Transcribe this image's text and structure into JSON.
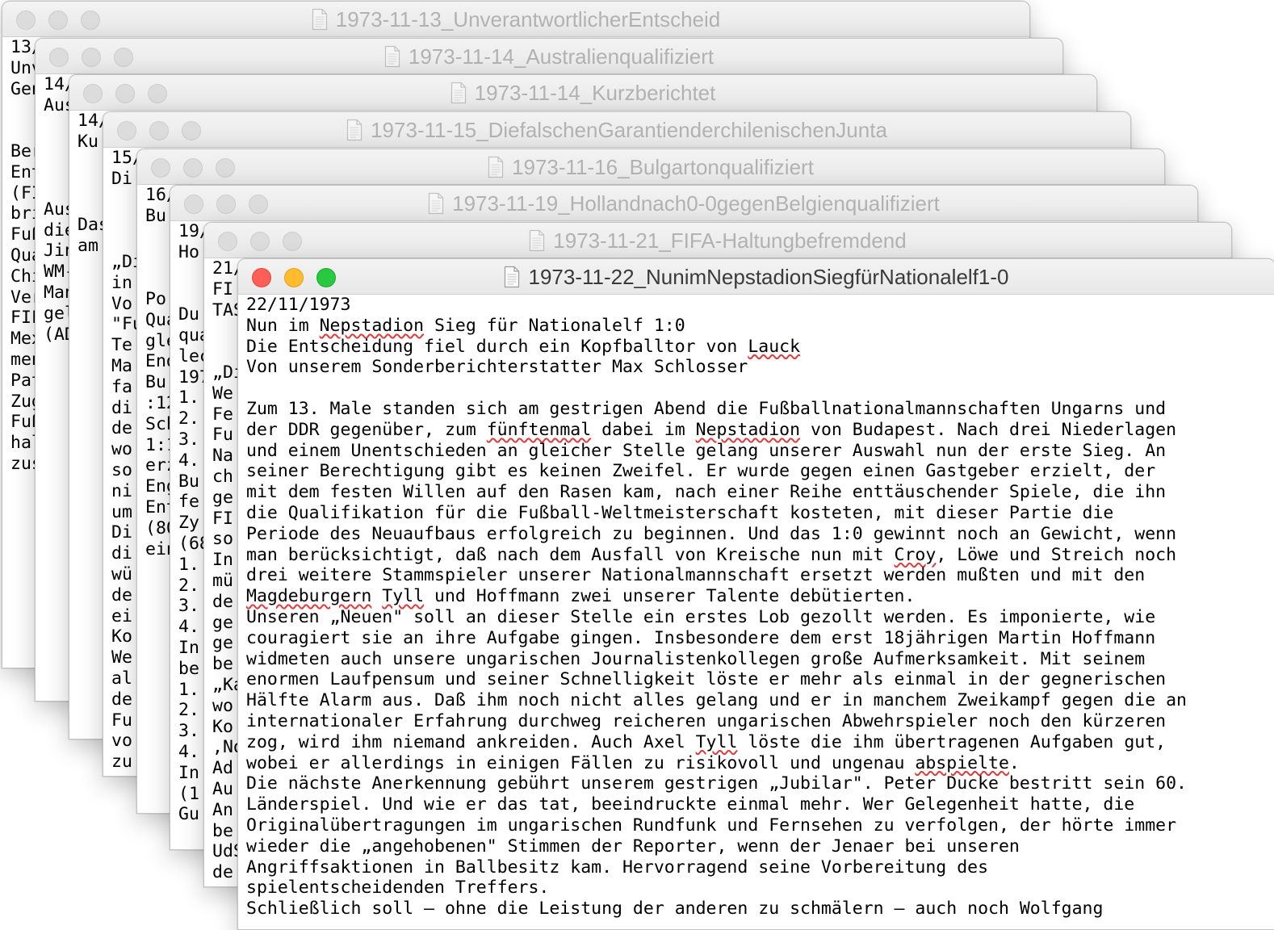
{
  "windows": [
    {
      "title": "1973-11-13_UnverantwortlicherEntscheid",
      "lines": [
        "13/",
        "Unv",
        "Gen",
        "",
        "",
        "Ber",
        "Ent",
        "(FI",
        "bri",
        "Fuß",
        "Qua",
        "Chi",
        "Ver",
        "FIF",
        "Mex",
        "men",
        "Pat",
        "Zug",
        "Fuß",
        "hal",
        "zus"
      ]
    },
    {
      "title": "1973-11-14_Australienqualifiziert",
      "lines": [
        "14/",
        "Aus",
        "",
        "",
        "",
        "",
        "Aus",
        "die",
        "Jin",
        "WM-",
        "Man",
        "gel",
        "(AD"
      ]
    },
    {
      "title": "1973-11-14_Kurzberichtet",
      "lines": [
        "14/",
        "Ku",
        "",
        "",
        "",
        "Das",
        "am"
      ]
    },
    {
      "title": "1973-11-15_DiefalschenGarantienderchilenischenJunta",
      "lines": [
        "15/",
        "Di",
        "",
        "",
        "",
        "„Di",
        "in",
        "Vo",
        "\"Fu",
        "Te",
        "Ma",
        "fa",
        "di",
        "de",
        "wo",
        "so",
        "ni",
        "um",
        "Di",
        "di",
        "wü",
        "de",
        "ei",
        "Ko",
        "We",
        "al",
        "de",
        "Fu",
        "vo",
        "zu"
      ]
    },
    {
      "title": "1973-11-16_Bulgartonqualifiziert",
      "lines": [
        "16/",
        "Bu",
        "",
        "",
        "",
        "Po",
        "Qua",
        "gle",
        "End",
        "Bu",
        ":12",
        "Sch",
        "1:1",
        "erz",
        "Eng",
        "Ent",
        "(80",
        "ein"
      ]
    },
    {
      "title": "1973-11-19_Hollandnach0-0gegenBelgienqualifiziert",
      "lines": [
        "19/",
        "Ho",
        "",
        "",
        "Du",
        "qua",
        "lec",
        "197",
        "1.",
        "2.",
        "3.",
        "4.",
        "Bu",
        "fe",
        "Zy",
        "(68",
        "1.",
        "2.",
        "3.",
        "4.",
        "In",
        "be",
        "1.",
        "2.",
        "3.",
        "4.",
        "In",
        "(1",
        "Gu"
      ]
    },
    {
      "title": "1973-11-21_FIFA-Haltungbefremdend",
      "lines": [
        "21/",
        "FI",
        "TAS",
        "",
        "",
        "„Di",
        "We",
        "Fe",
        "Fu",
        "Na",
        "ch",
        "ge",
        "FI",
        "so",
        "In",
        "mü",
        "de",
        "ge",
        "ge",
        "be",
        "„Ka",
        "wo",
        "Ko",
        ",No",
        "Ad",
        "Au",
        "An",
        "be",
        "UdS",
        "de"
      ]
    },
    {
      "title": "1973-11-22_NunimNepstadionSiegfürNationalelf1-0",
      "lines": [
        "22/11/1973",
        "Nun im Nepstadion Sieg für Nationalelf 1:0",
        "Die Entscheidung fiel durch ein Kopfballtor von Lauck",
        "Von unserem Sonderberichterstatter Max Schlosser",
        "",
        "Zum 13. Male standen sich am gestrigen Abend die Fußballnationalmannschaften Ungarns und",
        "der DDR gegenüber, zum fünftenmal dabei im Nepstadion von Budapest. Nach drei Niederlagen",
        "und einem Unentschieden an gleicher Stelle gelang unserer Auswahl nun der erste Sieg. An",
        "seiner Berechtigung gibt es keinen Zweifel. Er wurde gegen einen Gastgeber erzielt, der",
        "mit dem festen Willen auf den Rasen kam, nach einer Reihe enttäuschender Spiele, die ihn",
        "die Qualifikation für die Fußball-Weltmeisterschaft kosteten, mit dieser Partie die",
        "Periode des Neuaufbaus erfolgreich zu beginnen. Und das 1:0 gewinnt noch an Gewicht, wenn",
        "man berücksichtigt, daß nach dem Ausfall von Kreische nun mit Croy, Löwe und Streich noch",
        "drei weitere Stammspieler unserer Nationalmannschaft ersetzt werden mußten und mit den",
        "Magdeburgern Tyll und Hoffmann zwei unserer Talente debütierten.",
        "Unseren „Neuen\" soll an dieser Stelle ein erstes Lob gezollt werden. Es imponierte, wie",
        "couragiert sie an ihre Aufgabe gingen. Insbesondere dem erst 18jährigen Martin Hoffmann",
        "widmeten auch unsere ungarischen Journalistenkollegen große Aufmerksamkeit. Mit seinem",
        "enormen Laufpensum und seiner Schnelligkeit löste er mehr als einmal in der gegnerischen",
        "Hälfte Alarm aus. Daß ihm noch nicht alles gelang und er in manchem Zweikampf gegen die an",
        "internationaler Erfahrung durchweg reicheren ungarischen Abwehrspieler noch den kürzeren",
        "zog, wird ihm niemand ankreiden. Auch Axel Tyll löste die ihm übertragenen Aufgaben gut,",
        "wobei er allerdings in einigen Fällen zu risikovoll und ungenau abspielte.",
        "Die nächste Anerkennung gebührt unserem gestrigen „Jubilar\". Peter Ducke bestritt sein 60.",
        "Länderspiel. Und wie er das tat, beeindruckte einmal mehr. Wer Gelegenheit hatte, die",
        "Originalübertragungen im ungarischen Rundfunk und Fernsehen zu verfolgen, der hörte immer",
        "wieder die „angehobenen\" Stimmen der Reporter, wenn der Jenaer bei unseren",
        "Angriffsaktionen in Ballbesitz kam. Hervorragend seine Vorbereitung des",
        "spielentscheidenden Treffers.",
        "Schließlich soll – ohne die Leistung der anderen zu schmälern – auch noch Wolfgang"
      ],
      "misspelled_words": [
        "Nepstadion",
        "Lauck",
        "fünftenmal",
        "Croy",
        "Magdeburgern",
        "Tyll",
        "abspielte"
      ]
    }
  ],
  "colors": {
    "close": "#ff5f57",
    "minimize": "#febc2e",
    "maximize": "#28c840",
    "inactive_light": "#dcdcdc",
    "spell_underline": "#e23a3a"
  },
  "icons": {
    "window_title": "text-document-icon"
  }
}
